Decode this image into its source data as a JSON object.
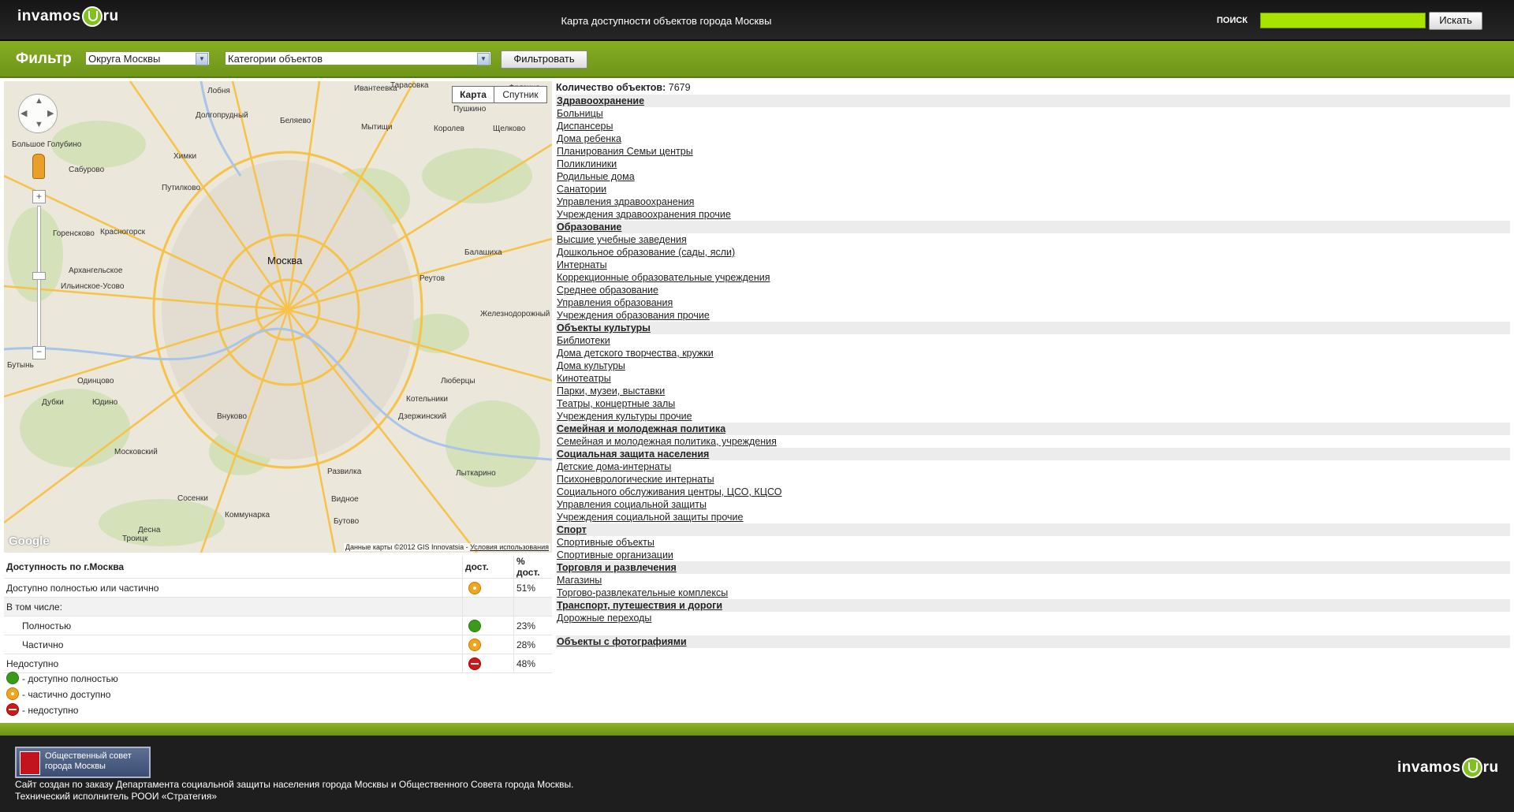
{
  "header": {
    "logo_left": "invamos",
    "logo_right": "ru",
    "site_title": "Карта доступности объектов города Москвы",
    "search_label": "ПОИСК",
    "search_value": "",
    "search_button": "Искать"
  },
  "filter": {
    "title": "Фильтр",
    "district_select": "Округа Москвы",
    "category_select": "Категории объектов",
    "filter_button": "Фильтровать"
  },
  "map": {
    "type_map": "Карта",
    "type_satellite": "Спутник",
    "city_label": "Москва",
    "google": "Google",
    "copyright": "Данные карты ©2012 GIS Innovatsia - ",
    "terms": "Условия использования",
    "labels": [
      "Ивантеевка",
      "Пушкино",
      "Тарасовка",
      "Долгопрудный",
      "Лобня",
      "Фрязино",
      "Беляево",
      "Мытищи",
      "Королев",
      "Щелково",
      "Химки",
      "Путилково",
      "Красногорск",
      "Балашиха",
      "Железнодорожный",
      "Реутов",
      "Одинцово",
      "Люберцы",
      "Котельники",
      "Дзержинский",
      "Видное",
      "Лыткарино",
      "Троицк",
      "Московский",
      "Развилка",
      "Бутово",
      "Коммунарка",
      "Большое Голубино",
      "Сабурово",
      "Горенсково",
      "Архангельское",
      "Ильинское-Усово",
      "Юдино",
      "Дубки",
      "Внуково",
      "Бутынь",
      "Десна",
      "Сосенки"
    ]
  },
  "accessibility": {
    "header_col1": "Доступность по г.Москва",
    "header_col2": "дост.",
    "header_col3": "% дост.",
    "rows": [
      {
        "label": "Доступно полностью или частично",
        "percent": "51%"
      },
      {
        "label": "В том числе:",
        "percent": ""
      },
      {
        "label": "Полностью",
        "percent": "23%"
      },
      {
        "label": "Частично",
        "percent": "28%"
      },
      {
        "label": "Недоступно",
        "percent": "48%"
      }
    ],
    "legend": {
      "full": "- доступно полностью",
      "partial": "- частично доступно",
      "none": "- недоступно"
    }
  },
  "objects": {
    "count_label": "Количество объектов:",
    "count_value": "7679",
    "cats": [
      {
        "name": "Здравоохранение",
        "items": [
          "Больницы",
          "Диспансеры",
          "Дома ребенка",
          "Планирования Семьи центры",
          "Поликлиники",
          "Родильные дома",
          "Санатории",
          "Управления здравоохранения",
          "Учреждения здравоохранения прочие"
        ]
      },
      {
        "name": "Образование",
        "items": [
          "Высшие учебные заведения",
          "Дошкольное образование (сады, ясли)",
          "Интернаты",
          "Коррекционные образовательные учреждения",
          "Среднее образование",
          "Управления образования",
          "Учреждения образования прочие"
        ]
      },
      {
        "name": "Объекты культуры",
        "items": [
          "Библиотеки",
          "Дома детского творчества, кружки",
          "Дома культуры",
          "Кинотеатры",
          "Парки, музеи, выставки",
          "Театры, концертные залы",
          "Учреждения культуры прочие"
        ]
      },
      {
        "name": "Семейная и молодежная политика",
        "items": [
          "Семейная и молодежная политика, учреждения"
        ]
      },
      {
        "name": "Социальная защита населения",
        "items": [
          "Детские дома-интернаты",
          "Психоневрологические интернаты",
          "Социального обслуживания центры, ЦСО, КЦСО",
          "Управления социальной защиты",
          "Учреждения социальной защиты прочие"
        ]
      },
      {
        "name": "Спорт",
        "items": [
          "Спортивные объекты",
          "Спортивные организации"
        ]
      },
      {
        "name": "Торговля и развлечения",
        "items": [
          "Магазины",
          "Торгово-развлекательные комплексы"
        ]
      },
      {
        "name": "Транспорт, путешествия и дороги",
        "items": [
          "Дорожные переходы"
        ]
      }
    ],
    "photo_cat": "Объекты с фотографиями"
  },
  "footer": {
    "council_badge": "Общественный совет города Москвы",
    "line1": "Сайт создан по заказу Департамента социальной защиты населения города Москвы и Общественного Совета города Москвы.",
    "line2": "Технический исполнитель РООИ «Стратегия»"
  },
  "colors": {
    "accent_green": "#7da51e",
    "search_green": "#a9e400",
    "status_full": "#3a9b1a",
    "status_partial": "#f4a31a",
    "status_none": "#d01818"
  }
}
